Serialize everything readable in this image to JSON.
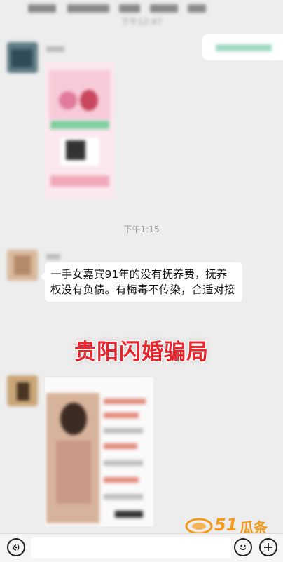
{
  "chat": {
    "timestamp_top": "下午12:47",
    "timestamp_mid": "下午1:15",
    "sender_name_1": "",
    "sender_name_2": "",
    "message_text": "一手女嘉宾91年的没有抚养费，抚养权没有负债。有梅毒不传染，合适对接"
  },
  "overlay": {
    "title": "贵阳闪婚骗局"
  },
  "watermark": {
    "number": "51",
    "text": "瓜条"
  },
  "colors": {
    "background": "#ededed",
    "bubble": "#ffffff",
    "title_red": "#e8262e",
    "watermark_orange": "#f39a1b"
  },
  "icons": [
    "voice-icon",
    "emoji-icon",
    "plus-icon",
    "avatar"
  ]
}
